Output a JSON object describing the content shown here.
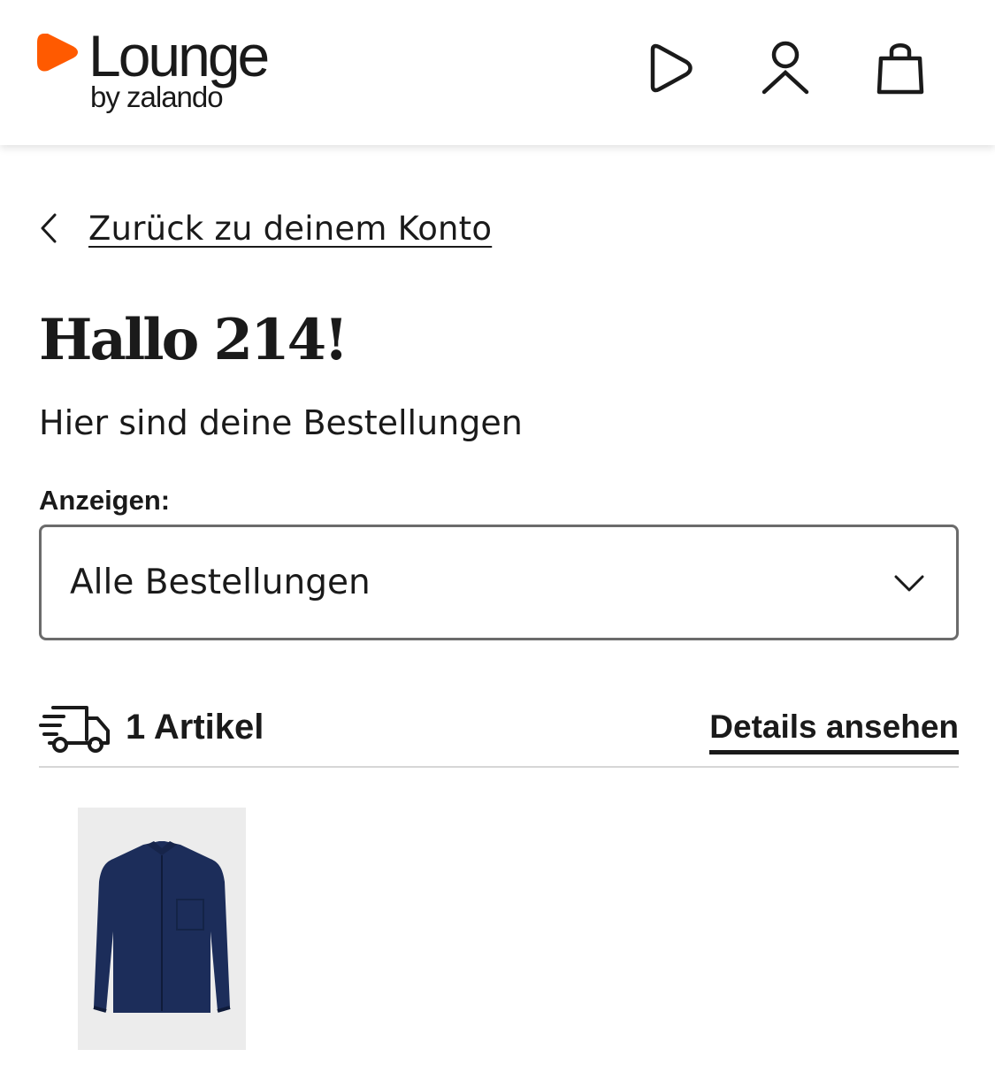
{
  "header": {
    "logo_word": "Lounge",
    "logo_sub": "by zalando",
    "brand_color": "#ff5a00",
    "icons": [
      "play-icon",
      "user-icon",
      "bag-icon"
    ]
  },
  "nav": {
    "back_label": "Zurück zu deinem Konto"
  },
  "page": {
    "title": "Hallo 214!",
    "subtitle": "Hier sind deine Bestellungen"
  },
  "filter": {
    "label": "Anzeigen:",
    "selected": "Alle Bestellungen"
  },
  "orders": [
    {
      "count_label": "1 Artikel",
      "details_label": "Details ansehen",
      "product_color": "#1c2d5a"
    }
  ]
}
